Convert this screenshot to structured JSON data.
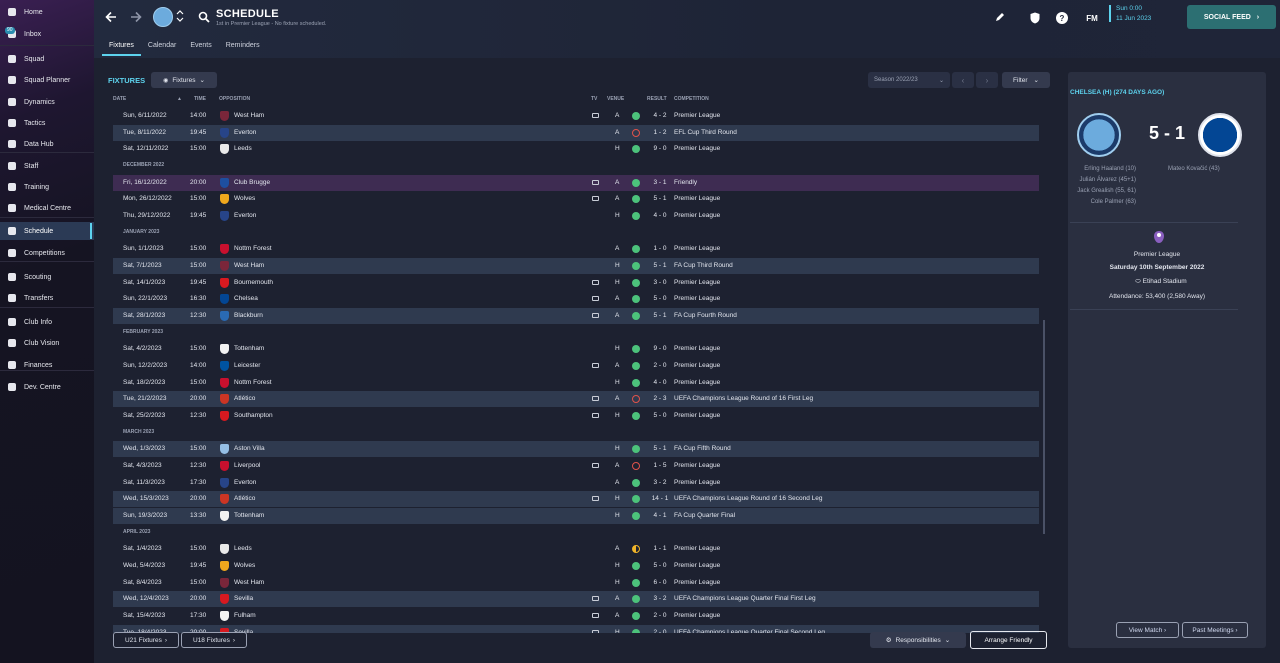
{
  "sidebar": {
    "items": [
      {
        "label": "Home",
        "icon": "home-icon"
      },
      {
        "label": "Inbox",
        "icon": "inbox-icon",
        "badge": "90"
      },
      {
        "label": "Squad",
        "icon": "shirt-icon"
      },
      {
        "label": "Squad Planner",
        "icon": "planner-icon"
      },
      {
        "label": "Dynamics",
        "icon": "dynamics-icon"
      },
      {
        "label": "Tactics",
        "icon": "tactics-icon"
      },
      {
        "label": "Data Hub",
        "icon": "data-hub-icon"
      },
      {
        "label": "Staff",
        "icon": "staff-icon"
      },
      {
        "label": "Training",
        "icon": "training-icon"
      },
      {
        "label": "Medical Centre",
        "icon": "medical-icon"
      },
      {
        "label": "Schedule",
        "icon": "calendar-icon",
        "active": true
      },
      {
        "label": "Competitions",
        "icon": "trophy-icon"
      },
      {
        "label": "Scouting",
        "icon": "scouting-icon"
      },
      {
        "label": "Transfers",
        "icon": "transfers-icon"
      },
      {
        "label": "Club Info",
        "icon": "shield-icon"
      },
      {
        "label": "Club Vision",
        "icon": "vision-icon"
      },
      {
        "label": "Finances",
        "icon": "finances-icon"
      },
      {
        "label": "Dev. Centre",
        "icon": "dev-centre-icon"
      }
    ]
  },
  "header": {
    "title": "SCHEDULE",
    "subtitle": "1st in Premier League - No fixture scheduled.",
    "tabs": [
      "Fixtures",
      "Calendar",
      "Events",
      "Reminders"
    ],
    "date_line1": "Sun 0:00",
    "date_line2": "11 Jun 2023",
    "fm_label": "FM",
    "social_feed": "SOCIAL FEED",
    "accent": "#5dd3ee"
  },
  "toolbar": {
    "fixtures_title": "FIXTURES",
    "fixtures_dropdown": "Fixtures",
    "season": "Season 2022/23",
    "filter": "Filter"
  },
  "table": {
    "headers": {
      "date": "DATE",
      "time": "TIME",
      "opposition": "OPPOSITION",
      "tv": "TV",
      "venue": "VENUE",
      "result": "RESULT",
      "competition": "COMPETITION"
    },
    "rows": [
      {
        "kind": "match",
        "date": "Sun, 6/11/2022",
        "time": "14:00",
        "opp": "West Ham",
        "crest": "#7a263a",
        "tv": true,
        "venue": "A",
        "outcome": "win",
        "result": "4 - 2",
        "comp": "Premier League"
      },
      {
        "kind": "match",
        "date": "Tue, 8/11/2022",
        "time": "19:45",
        "opp": "Everton",
        "crest": "#274488",
        "tv": false,
        "venue": "A",
        "outcome": "loss",
        "result": "1 - 2",
        "comp": "EFL Cup Third Round",
        "hl": "alt"
      },
      {
        "kind": "match",
        "date": "Sat, 12/11/2022",
        "time": "15:00",
        "opp": "Leeds",
        "crest": "#e9e9e9",
        "tv": false,
        "venue": "H",
        "outcome": "win",
        "result": "9 - 0",
        "comp": "Premier League"
      },
      {
        "kind": "month",
        "label": "DECEMBER 2022"
      },
      {
        "kind": "match",
        "date": "Fri, 16/12/2022",
        "time": "20:00",
        "opp": "Club Brugge",
        "crest": "#1e4fa0",
        "tv": true,
        "venue": "A",
        "outcome": "win",
        "result": "3 - 1",
        "comp": "Friendly",
        "hl": "friendly"
      },
      {
        "kind": "match",
        "date": "Mon, 26/12/2022",
        "time": "15:00",
        "opp": "Wolves",
        "crest": "#f0a81d",
        "tv": true,
        "venue": "A",
        "outcome": "win",
        "result": "5 - 1",
        "comp": "Premier League"
      },
      {
        "kind": "match",
        "date": "Thu, 29/12/2022",
        "time": "19:45",
        "opp": "Everton",
        "crest": "#274488",
        "tv": false,
        "venue": "H",
        "outcome": "win",
        "result": "4 - 0",
        "comp": "Premier League"
      },
      {
        "kind": "month",
        "label": "JANUARY 2023"
      },
      {
        "kind": "match",
        "date": "Sun, 1/1/2023",
        "time": "15:00",
        "opp": "Nottm Forest",
        "crest": "#c8102e",
        "tv": false,
        "venue": "A",
        "outcome": "win",
        "result": "1 - 0",
        "comp": "Premier League"
      },
      {
        "kind": "match",
        "date": "Sat, 7/1/2023",
        "time": "15:00",
        "opp": "West Ham",
        "crest": "#7a263a",
        "tv": false,
        "venue": "H",
        "outcome": "win",
        "result": "5 - 1",
        "comp": "FA Cup Third Round",
        "hl": "alt"
      },
      {
        "kind": "match",
        "date": "Sat, 14/1/2023",
        "time": "19:45",
        "opp": "Bournemouth",
        "crest": "#d71920",
        "tv": true,
        "venue": "H",
        "outcome": "win",
        "result": "3 - 0",
        "comp": "Premier League"
      },
      {
        "kind": "match",
        "date": "Sun, 22/1/2023",
        "time": "16:30",
        "opp": "Chelsea",
        "crest": "#034694",
        "tv": true,
        "venue": "A",
        "outcome": "win",
        "result": "5 - 0",
        "comp": "Premier League"
      },
      {
        "kind": "match",
        "date": "Sat, 28/1/2023",
        "time": "12:30",
        "opp": "Blackburn",
        "crest": "#2a6ab3",
        "tv": true,
        "venue": "A",
        "outcome": "win",
        "result": "5 - 1",
        "comp": "FA Cup Fourth Round",
        "hl": "alt"
      },
      {
        "kind": "month",
        "label": "FEBRUARY 2023"
      },
      {
        "kind": "match",
        "date": "Sat, 4/2/2023",
        "time": "15:00",
        "opp": "Tottenham",
        "crest": "#f2f2f2",
        "tv": false,
        "venue": "H",
        "outcome": "win",
        "result": "9 - 0",
        "comp": "Premier League"
      },
      {
        "kind": "match",
        "date": "Sun, 12/2/2023",
        "time": "14:00",
        "opp": "Leicester",
        "crest": "#0053a0",
        "tv": true,
        "venue": "A",
        "outcome": "win",
        "result": "2 - 0",
        "comp": "Premier League"
      },
      {
        "kind": "match",
        "date": "Sat, 18/2/2023",
        "time": "15:00",
        "opp": "Nottm Forest",
        "crest": "#c8102e",
        "tv": false,
        "venue": "H",
        "outcome": "win",
        "result": "4 - 0",
        "comp": "Premier League"
      },
      {
        "kind": "match",
        "date": "Tue, 21/2/2023",
        "time": "20:00",
        "opp": "Atlético",
        "crest": "#cb3524",
        "tv": true,
        "venue": "A",
        "outcome": "loss",
        "result": "2 - 3",
        "comp": "UEFA Champions League Round of 16 First Leg",
        "hl": "alt"
      },
      {
        "kind": "match",
        "date": "Sat, 25/2/2023",
        "time": "12:30",
        "opp": "Southampton",
        "crest": "#d71920",
        "tv": true,
        "venue": "H",
        "outcome": "win",
        "result": "5 - 0",
        "comp": "Premier League"
      },
      {
        "kind": "month",
        "label": "MARCH 2023"
      },
      {
        "kind": "match",
        "date": "Wed, 1/3/2023",
        "time": "15:00",
        "opp": "Aston Villa",
        "crest": "#95bfe5",
        "tv": false,
        "venue": "H",
        "outcome": "win",
        "result": "5 - 1",
        "comp": "FA Cup Fifth Round",
        "hl": "alt"
      },
      {
        "kind": "match",
        "date": "Sat, 4/3/2023",
        "time": "12:30",
        "opp": "Liverpool",
        "crest": "#c8102e",
        "tv": true,
        "venue": "A",
        "outcome": "loss",
        "result": "1 - 5",
        "comp": "Premier League"
      },
      {
        "kind": "match",
        "date": "Sat, 11/3/2023",
        "time": "17:30",
        "opp": "Everton",
        "crest": "#274488",
        "tv": false,
        "venue": "A",
        "outcome": "win",
        "result": "3 - 2",
        "comp": "Premier League"
      },
      {
        "kind": "match",
        "date": "Wed, 15/3/2023",
        "time": "20:00",
        "opp": "Atlético",
        "crest": "#cb3524",
        "tv": true,
        "venue": "H",
        "outcome": "win",
        "result": "14 - 1",
        "comp": "UEFA Champions League Round of 16 Second Leg",
        "hl": "alt"
      },
      {
        "kind": "match",
        "date": "Sun, 19/3/2023",
        "time": "13:30",
        "opp": "Tottenham",
        "crest": "#f2f2f2",
        "tv": false,
        "venue": "H",
        "outcome": "win",
        "result": "4 - 1",
        "comp": "FA Cup Quarter Final",
        "hl": "alt"
      },
      {
        "kind": "month",
        "label": "APRIL 2023"
      },
      {
        "kind": "match",
        "date": "Sat, 1/4/2023",
        "time": "15:00",
        "opp": "Leeds",
        "crest": "#e9e9e9",
        "tv": false,
        "venue": "A",
        "outcome": "draw",
        "result": "1 - 1",
        "comp": "Premier League"
      },
      {
        "kind": "match",
        "date": "Wed, 5/4/2023",
        "time": "19:45",
        "opp": "Wolves",
        "crest": "#f0a81d",
        "tv": false,
        "venue": "H",
        "outcome": "win",
        "result": "5 - 0",
        "comp": "Premier League"
      },
      {
        "kind": "match",
        "date": "Sat, 8/4/2023",
        "time": "15:00",
        "opp": "West Ham",
        "crest": "#7a263a",
        "tv": false,
        "venue": "H",
        "outcome": "win",
        "result": "6 - 0",
        "comp": "Premier League"
      },
      {
        "kind": "match",
        "date": "Wed, 12/4/2023",
        "time": "20:00",
        "opp": "Sevilla",
        "crest": "#d71920",
        "tv": true,
        "venue": "A",
        "outcome": "win",
        "result": "3 - 2",
        "comp": "UEFA Champions League Quarter Final First Leg",
        "hl": "alt"
      },
      {
        "kind": "match",
        "date": "Sat, 15/4/2023",
        "time": "17:30",
        "opp": "Fulham",
        "crest": "#f2f2f2",
        "tv": true,
        "venue": "A",
        "outcome": "win",
        "result": "2 - 0",
        "comp": "Premier League"
      },
      {
        "kind": "match",
        "date": "Tue, 18/4/2023",
        "time": "20:00",
        "opp": "Sevilla",
        "crest": "#d71920",
        "tv": true,
        "venue": "H",
        "outcome": "win",
        "result": "2 - 0",
        "comp": "UEFA Champions League Quarter Final Second Leg",
        "hl": "alt"
      }
    ]
  },
  "footer": {
    "u21": "U21 Fixtures",
    "u18": "U18 Fixtures",
    "responsibilities": "Responsibilities",
    "arrange": "Arrange Friendly"
  },
  "panel": {
    "title": "CHELSEA (H) (274 DAYS AGO)",
    "score": "5 - 1",
    "home_scorers": [
      "Erling Haaland (10)",
      "Julián Álvarez (45+1)",
      "Jack Grealish (55, 61)",
      "Cole Palmer (63)"
    ],
    "away_scorers": [
      "Mateo Kovačić (43)"
    ],
    "competition": "Premier League",
    "date": "Saturday 10th September 2022",
    "stadium": "Etihad Stadium",
    "attendance": "Attendance: 53,400 (2,580 Away)",
    "view_match": "View Match",
    "past_meetings": "Past Meetings",
    "home_color": "#6cabdd",
    "away_color": "#034694"
  }
}
